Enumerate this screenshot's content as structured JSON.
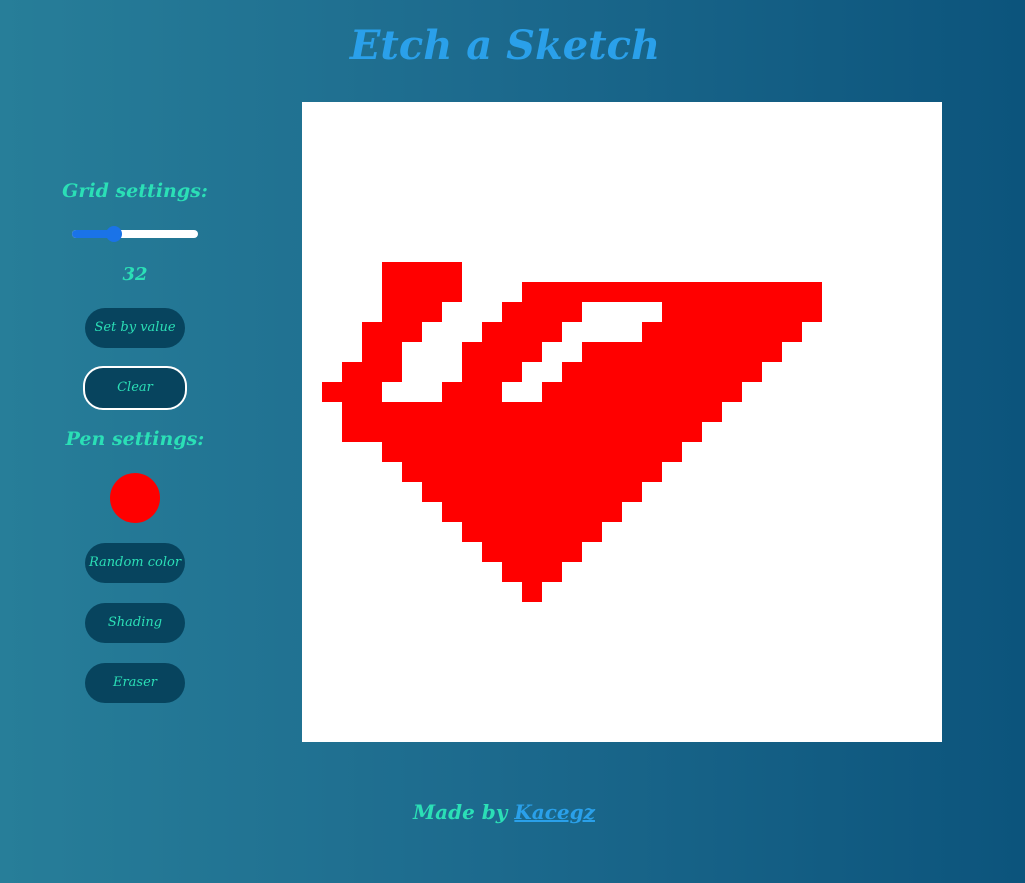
{
  "header": {
    "title": "Etch a Sketch"
  },
  "grid_settings": {
    "heading": "Grid settings:",
    "slider_fraction": 0.33,
    "size_value": "32",
    "set_by_value_label": "Set by value",
    "clear_label": "Clear"
  },
  "pen_settings": {
    "heading": "Pen settings:",
    "color": "#ff0000",
    "random_color_label": "Random color",
    "shading_label": "Shading",
    "eraser_label": "Eraser"
  },
  "board": {
    "grid_size": 32,
    "background": "#ffffff",
    "filled_cells": [
      [
        8,
        4
      ],
      [
        8,
        5
      ],
      [
        8,
        6
      ],
      [
        8,
        7
      ],
      [
        9,
        4
      ],
      [
        9,
        5
      ],
      [
        9,
        6
      ],
      [
        9,
        7
      ],
      [
        9,
        11
      ],
      [
        9,
        12
      ],
      [
        9,
        13
      ],
      [
        9,
        14
      ],
      [
        9,
        15
      ],
      [
        9,
        16
      ],
      [
        9,
        17
      ],
      [
        9,
        18
      ],
      [
        9,
        19
      ],
      [
        9,
        20
      ],
      [
        9,
        21
      ],
      [
        9,
        22
      ],
      [
        9,
        23
      ],
      [
        9,
        24
      ],
      [
        9,
        25
      ],
      [
        10,
        4
      ],
      [
        10,
        5
      ],
      [
        10,
        6
      ],
      [
        10,
        10
      ],
      [
        10,
        11
      ],
      [
        10,
        12
      ],
      [
        10,
        13
      ],
      [
        10,
        18
      ],
      [
        10,
        19
      ],
      [
        10,
        20
      ],
      [
        10,
        21
      ],
      [
        10,
        22
      ],
      [
        10,
        23
      ],
      [
        10,
        24
      ],
      [
        10,
        25
      ],
      [
        11,
        3
      ],
      [
        11,
        4
      ],
      [
        11,
        5
      ],
      [
        11,
        9
      ],
      [
        11,
        10
      ],
      [
        11,
        11
      ],
      [
        11,
        12
      ],
      [
        11,
        17
      ],
      [
        11,
        18
      ],
      [
        11,
        19
      ],
      [
        11,
        20
      ],
      [
        11,
        21
      ],
      [
        11,
        22
      ],
      [
        11,
        23
      ],
      [
        11,
        24
      ],
      [
        12,
        3
      ],
      [
        12,
        4
      ],
      [
        12,
        8
      ],
      [
        12,
        9
      ],
      [
        12,
        10
      ],
      [
        12,
        11
      ],
      [
        12,
        14
      ],
      [
        12,
        15
      ],
      [
        12,
        16
      ],
      [
        12,
        17
      ],
      [
        12,
        18
      ],
      [
        12,
        19
      ],
      [
        12,
        20
      ],
      [
        12,
        21
      ],
      [
        12,
        22
      ],
      [
        12,
        23
      ],
      [
        13,
        2
      ],
      [
        13,
        3
      ],
      [
        13,
        4
      ],
      [
        13,
        8
      ],
      [
        13,
        9
      ],
      [
        13,
        10
      ],
      [
        13,
        13
      ],
      [
        13,
        14
      ],
      [
        13,
        15
      ],
      [
        13,
        16
      ],
      [
        13,
        17
      ],
      [
        13,
        18
      ],
      [
        13,
        19
      ],
      [
        13,
        20
      ],
      [
        13,
        21
      ],
      [
        13,
        22
      ],
      [
        14,
        1
      ],
      [
        14,
        2
      ],
      [
        14,
        3
      ],
      [
        14,
        7
      ],
      [
        14,
        8
      ],
      [
        14,
        9
      ],
      [
        14,
        12
      ],
      [
        14,
        13
      ],
      [
        14,
        14
      ],
      [
        14,
        15
      ],
      [
        14,
        16
      ],
      [
        14,
        17
      ],
      [
        14,
        18
      ],
      [
        14,
        19
      ],
      [
        14,
        20
      ],
      [
        14,
        21
      ],
      [
        15,
        2
      ],
      [
        15,
        3
      ],
      [
        15,
        4
      ],
      [
        15,
        5
      ],
      [
        15,
        6
      ],
      [
        15,
        7
      ],
      [
        15,
        8
      ],
      [
        15,
        9
      ],
      [
        15,
        10
      ],
      [
        15,
        11
      ],
      [
        15,
        12
      ],
      [
        15,
        13
      ],
      [
        15,
        14
      ],
      [
        15,
        15
      ],
      [
        15,
        16
      ],
      [
        15,
        17
      ],
      [
        15,
        18
      ],
      [
        15,
        19
      ],
      [
        15,
        20
      ],
      [
        16,
        2
      ],
      [
        16,
        3
      ],
      [
        16,
        4
      ],
      [
        16,
        5
      ],
      [
        16,
        6
      ],
      [
        16,
        7
      ],
      [
        16,
        8
      ],
      [
        16,
        9
      ],
      [
        16,
        10
      ],
      [
        16,
        11
      ],
      [
        16,
        12
      ],
      [
        16,
        13
      ],
      [
        16,
        14
      ],
      [
        16,
        15
      ],
      [
        16,
        16
      ],
      [
        16,
        17
      ],
      [
        16,
        18
      ],
      [
        16,
        19
      ],
      [
        17,
        4
      ],
      [
        17,
        5
      ],
      [
        17,
        6
      ],
      [
        17,
        7
      ],
      [
        17,
        8
      ],
      [
        17,
        9
      ],
      [
        17,
        10
      ],
      [
        17,
        11
      ],
      [
        17,
        12
      ],
      [
        17,
        13
      ],
      [
        17,
        14
      ],
      [
        17,
        15
      ],
      [
        17,
        16
      ],
      [
        17,
        17
      ],
      [
        17,
        18
      ],
      [
        18,
        5
      ],
      [
        18,
        6
      ],
      [
        18,
        7
      ],
      [
        18,
        8
      ],
      [
        18,
        9
      ],
      [
        18,
        10
      ],
      [
        18,
        11
      ],
      [
        18,
        12
      ],
      [
        18,
        13
      ],
      [
        18,
        14
      ],
      [
        18,
        15
      ],
      [
        18,
        16
      ],
      [
        18,
        17
      ],
      [
        19,
        6
      ],
      [
        19,
        7
      ],
      [
        19,
        8
      ],
      [
        19,
        9
      ],
      [
        19,
        10
      ],
      [
        19,
        11
      ],
      [
        19,
        12
      ],
      [
        19,
        13
      ],
      [
        19,
        14
      ],
      [
        19,
        15
      ],
      [
        19,
        16
      ],
      [
        20,
        7
      ],
      [
        20,
        8
      ],
      [
        20,
        9
      ],
      [
        20,
        10
      ],
      [
        20,
        11
      ],
      [
        20,
        12
      ],
      [
        20,
        13
      ],
      [
        20,
        14
      ],
      [
        20,
        15
      ],
      [
        21,
        8
      ],
      [
        21,
        9
      ],
      [
        21,
        10
      ],
      [
        21,
        11
      ],
      [
        21,
        12
      ],
      [
        21,
        13
      ],
      [
        21,
        14
      ],
      [
        22,
        9
      ],
      [
        22,
        10
      ],
      [
        22,
        11
      ],
      [
        22,
        12
      ],
      [
        22,
        13
      ],
      [
        23,
        10
      ],
      [
        23,
        11
      ],
      [
        23,
        12
      ],
      [
        24,
        11
      ]
    ]
  },
  "footer": {
    "prefix": "Made by ",
    "author": "Kacegz"
  }
}
